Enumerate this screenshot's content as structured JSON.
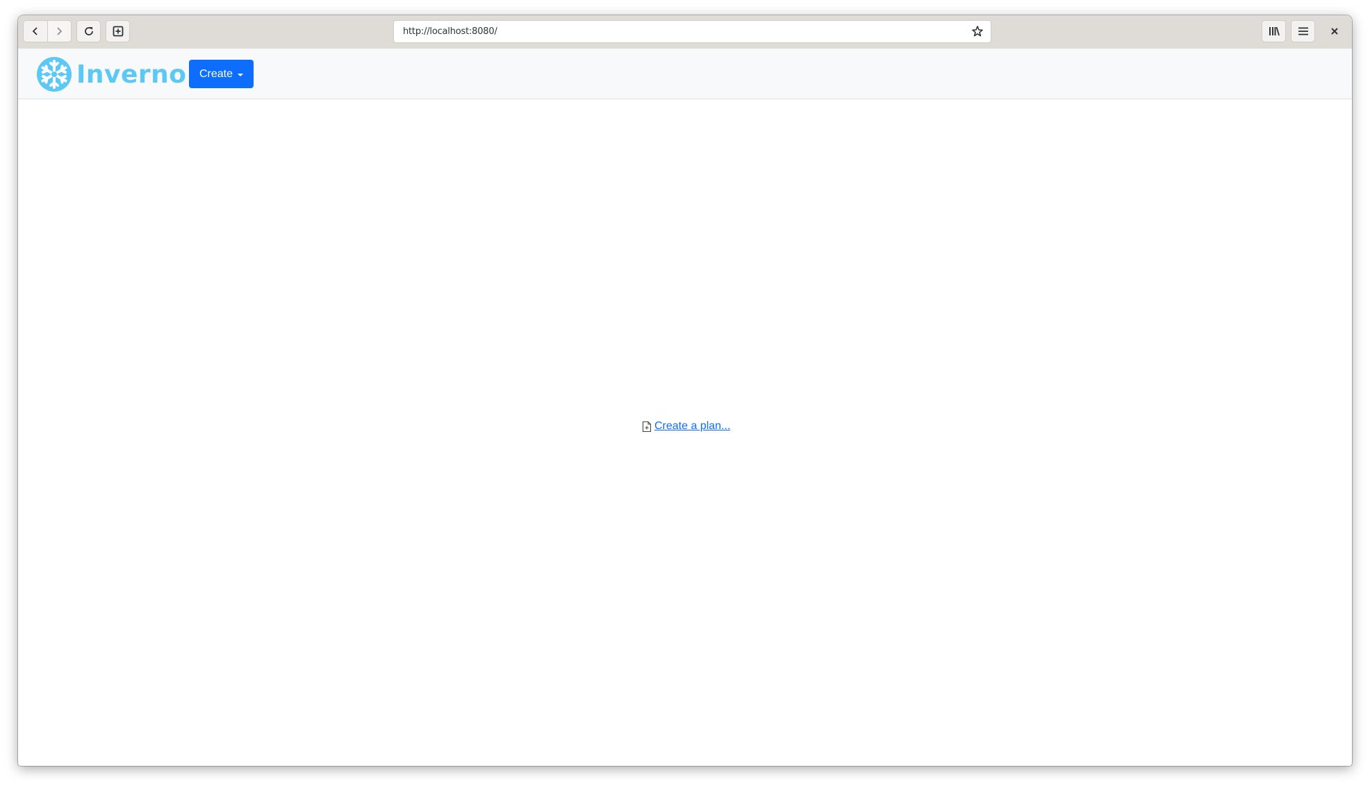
{
  "browser": {
    "url": "http://localhost:8080/",
    "buttons": {
      "back": "back-icon",
      "forward": "forward-icon",
      "reload": "reload-icon",
      "new_tab": "new-tab-icon",
      "bookmark": "star-icon",
      "library": "library-icon",
      "menu": "hamburger-icon",
      "close": "close-icon"
    }
  },
  "app": {
    "brand": "Inverno",
    "brand_color": "#5bc8f5",
    "accent_color": "#0d6efd",
    "create_label": "Create"
  },
  "main": {
    "link_label": "Create a plan..."
  }
}
